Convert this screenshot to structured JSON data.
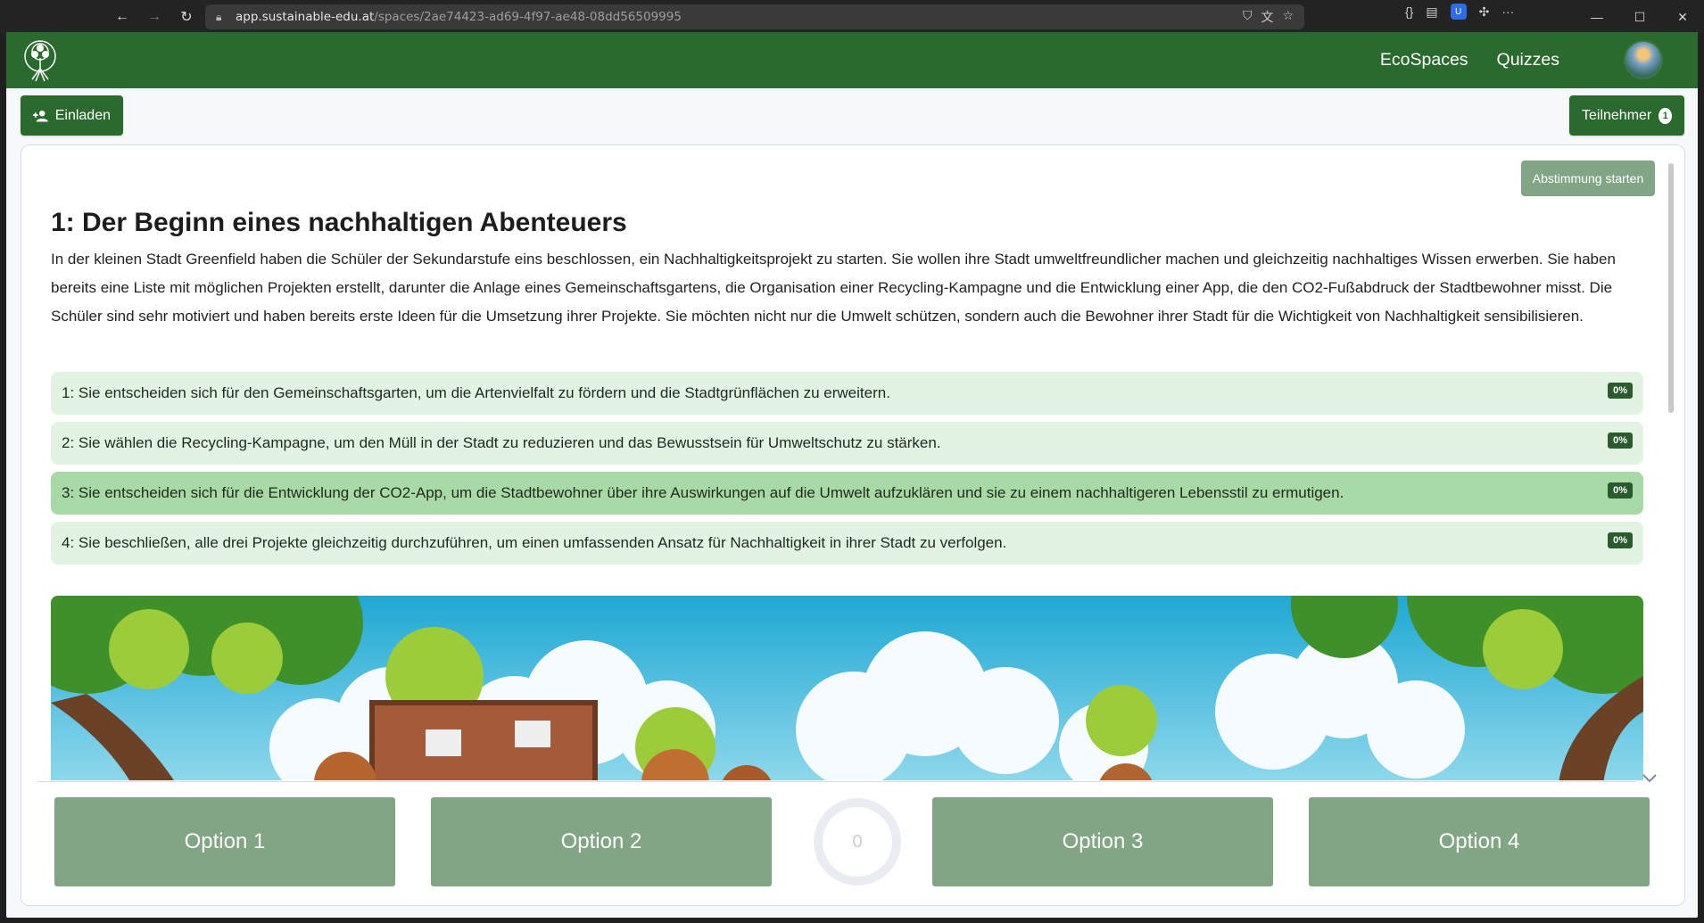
{
  "browser": {
    "url_host": "app.sustainable-edu.at",
    "url_path": "/spaces/2ae74423-ad69-4f97-ae48-08dd56509995"
  },
  "header": {
    "nav": [
      "EcoSpaces",
      "Quizzes"
    ]
  },
  "toolbar": {
    "invite_label": "Einladen",
    "participants_label": "Teilnehmer",
    "participants_count": "1"
  },
  "card": {
    "vote_label": "Abstimmung starten",
    "title": "1: Der Beginn eines nachhaltigen Abenteuers",
    "description": "In der kleinen Stadt Greenfield haben die Schüler der Sekundarstufe eins beschlossen, ein Nachhaltigkeitsprojekt zu starten. Sie wollen ihre Stadt umweltfreundlicher machen und gleichzeitig nachhaltiges Wissen erwerben. Sie haben bereits eine Liste mit möglichen Projekten erstellt, darunter die Anlage eines Gemeinschaftsgartens, die Organisation einer Recycling-Kampagne und die Entwicklung einer App, die den CO2-Fußabdruck der Stadtbewohner misst. Die Schüler sind sehr motiviert und haben bereits erste Ideen für die Umsetzung ihrer Projekte. Sie möchten nicht nur die Umwelt schützen, sondern auch die Bewohner ihrer Stadt für die Wichtigkeit von Nachhaltigkeit sensibilisieren.",
    "options": [
      {
        "text": "1: Sie entscheiden sich für den Gemeinschaftsgarten, um die Artenvielfalt zu fördern und die Stadtgrünflächen zu erweitern.",
        "percent": "0%",
        "selected": false
      },
      {
        "text": "2: Sie wählen die Recycling-Kampagne, um den Müll in der Stadt zu reduzieren und das Bewusstsein für Umweltschutz zu stärken.",
        "percent": "0%",
        "selected": false
      },
      {
        "text": "3: Sie entscheiden sich für die Entwicklung der CO2-App, um die Stadtbewohner über ihre Auswirkungen auf die Umwelt aufzuklären und sie zu einem nachhaltigeren Lebensstil zu ermutigen.",
        "percent": "0%",
        "selected": true
      },
      {
        "text": "4: Sie beschließen, alle drei Projekte gleichzeitig durchzuführen, um einen umfassenden Ansatz für Nachhaltigkeit in ihrer Stadt zu verfolgen.",
        "percent": "0%",
        "selected": false
      }
    ]
  },
  "answers": [
    "Option 1",
    "Option 2",
    "Option 3",
    "Option 4"
  ],
  "timer_value": "0",
  "colors": {
    "primary": "#2b6a2e",
    "option_bg": "#e3f3e3",
    "option_selected": "#a9d9a6",
    "answer_button": "#82a585"
  }
}
